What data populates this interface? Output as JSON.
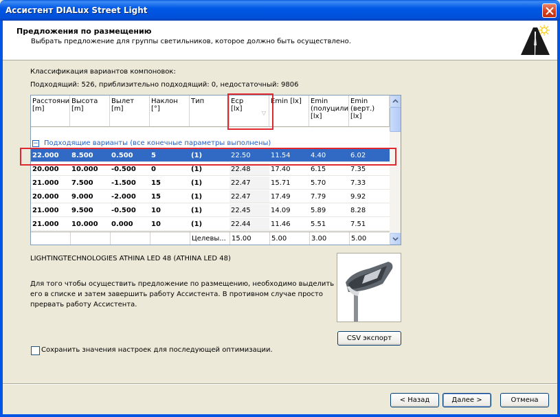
{
  "window": {
    "title": "Ассистент DIALux Street Light"
  },
  "header": {
    "title": "Предложения по размещению",
    "subtitle": "Выбрать предложение для группы светильников, которое должно быть осуществлено."
  },
  "classification": {
    "title": "Классификация вариантов компоновок:",
    "counts": "Подходящий: 526, приблизительно подходящий: 0, недостаточный: 9806"
  },
  "table": {
    "columns": [
      {
        "key": "dist",
        "label": "Расстояни\n[m]"
      },
      {
        "key": "height",
        "label": "Высота\n[m]"
      },
      {
        "key": "overhang",
        "label": "Вылет [m]"
      },
      {
        "key": "tilt",
        "label": "Наклон\n[°]"
      },
      {
        "key": "type",
        "label": "Тип"
      },
      {
        "key": "ecp",
        "label": "Eср\n[lx]"
      },
      {
        "key": "emin",
        "label": "Emin [lx]"
      },
      {
        "key": "emin_hs",
        "label": "Emin\n(полуцили\n[lx]"
      },
      {
        "key": "emin_v",
        "label": "Emin\n(верт.)\n[lx]"
      }
    ],
    "group_label": "Подходящие варианты (все конечные параметры выполнены)",
    "group_toggle": "−",
    "rows": [
      [
        "22.000",
        "8.500",
        "0.500",
        "5",
        "(1)",
        "22.50",
        "11.54",
        "4.40",
        "6.02"
      ],
      [
        "20.000",
        "10.000",
        "-0.500",
        "0",
        "(1)",
        "22.48",
        "17.40",
        "6.15",
        "7.35"
      ],
      [
        "21.000",
        "7.500",
        "-1.500",
        "15",
        "(1)",
        "22.47",
        "15.71",
        "5.70",
        "7.33"
      ],
      [
        "20.000",
        "9.000",
        "-2.000",
        "15",
        "(1)",
        "22.47",
        "17.49",
        "7.79",
        "9.92"
      ],
      [
        "21.000",
        "9.500",
        "-0.500",
        "10",
        "(1)",
        "22.45",
        "14.09",
        "5.89",
        "8.28"
      ],
      [
        "21.000",
        "10.000",
        "0.000",
        "10",
        "(1)",
        "22.44",
        "11.46",
        "5.51",
        "7.51"
      ]
    ],
    "selected_row": 0,
    "summary": {
      "label": "Целевы...",
      "ecp": "15.00",
      "emin": "5.00",
      "emin_hs": "3.00",
      "emin_v": "5.00"
    }
  },
  "luminaire": {
    "name": "LIGHTINGTECHNOLOGIES  ATHINA LED 48 (ATHINA LED 48)"
  },
  "instructions": {
    "line1": "Для того чтобы осуществить предложение по размещению, необходимо выделить",
    "line2": "его в списке и затем завершить работу Ассистента. В противном случае просто",
    "line3": "прервать работу Ассистента."
  },
  "csv_button": "CSV экспорт",
  "save_settings": {
    "label": "Сохранить значения настроек для последующей оптимизации.",
    "checked": false
  },
  "buttons": {
    "back": "< Назад",
    "next": "Далее >",
    "cancel": "Отмена"
  },
  "colors": {
    "selection": "#316AC5",
    "highlight_box": "#E0262E",
    "group_text": "#215DC6"
  }
}
